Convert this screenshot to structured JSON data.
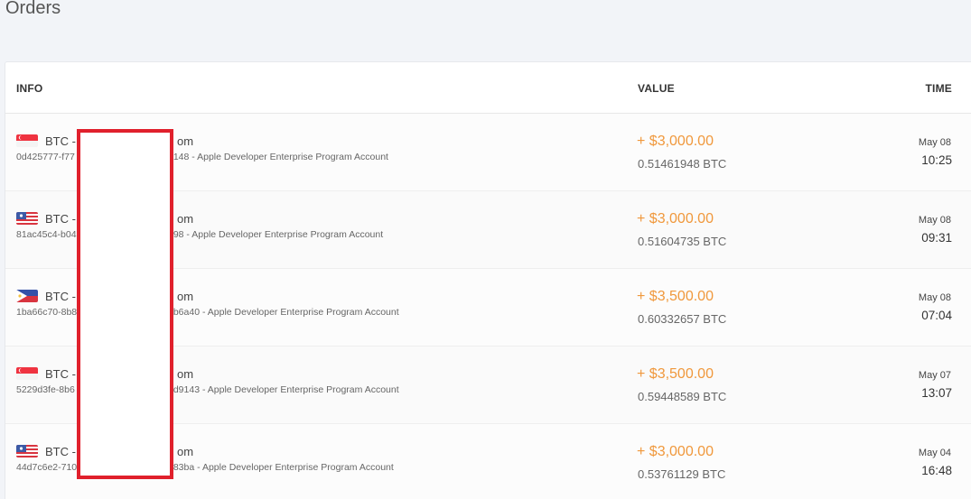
{
  "page": {
    "title": "Orders"
  },
  "table": {
    "headers": {
      "info": "INFO",
      "value": "VALUE",
      "time": "TIME"
    },
    "rows": [
      {
        "flag": "singapore-flag-icon",
        "line1_prefix": "BTC -",
        "line1_suffix": "om",
        "line2_prefix": "0d425777-f77",
        "line2_suffix": "d148 - Apple Developer Enterprise Program Account",
        "fiat": "+ $3,000.00",
        "btc": "0.51461948 BTC",
        "date": "May 08",
        "time": "10:25"
      },
      {
        "flag": "usa-flag-icon",
        "line1_prefix": "BTC -",
        "line1_suffix": "om",
        "line2_prefix": "81ac45c4-b04",
        "line2_suffix": "498 - Apple Developer Enterprise Program Account",
        "fiat": "+ $3,000.00",
        "btc": "0.51604735 BTC",
        "date": "May 08",
        "time": "09:31"
      },
      {
        "flag": "philippines-flag-icon",
        "line1_prefix": "BTC -",
        "line1_suffix": "om",
        "line2_prefix": "1ba66c70-8b8",
        "line2_suffix": "4b6a40 - Apple Developer Enterprise Program Account",
        "fiat": "+ $3,500.00",
        "btc": "0.60332657 BTC",
        "date": "May 08",
        "time": "07:04"
      },
      {
        "flag": "singapore-flag-icon",
        "line1_prefix": "BTC -",
        "line1_suffix": "om",
        "line2_prefix": "5229d3fe-8b6",
        "line2_suffix": "5d9143 - Apple Developer Enterprise Program Account",
        "fiat": "+ $3,500.00",
        "btc": "0.59448589 BTC",
        "date": "May 07",
        "time": "13:07"
      },
      {
        "flag": "usa-flag-icon",
        "line1_prefix": "BTC -",
        "line1_suffix": "om",
        "line2_prefix": "44d7c6e2-710",
        "line2_suffix": "683ba - Apple Developer Enterprise Program Account",
        "fiat": "+ $3,000.00",
        "btc": "0.53761129 BTC",
        "date": "May 04",
        "time": "16:48"
      }
    ]
  },
  "colors": {
    "accent_value": "#f0983c",
    "redaction_border": "#e0202c"
  }
}
